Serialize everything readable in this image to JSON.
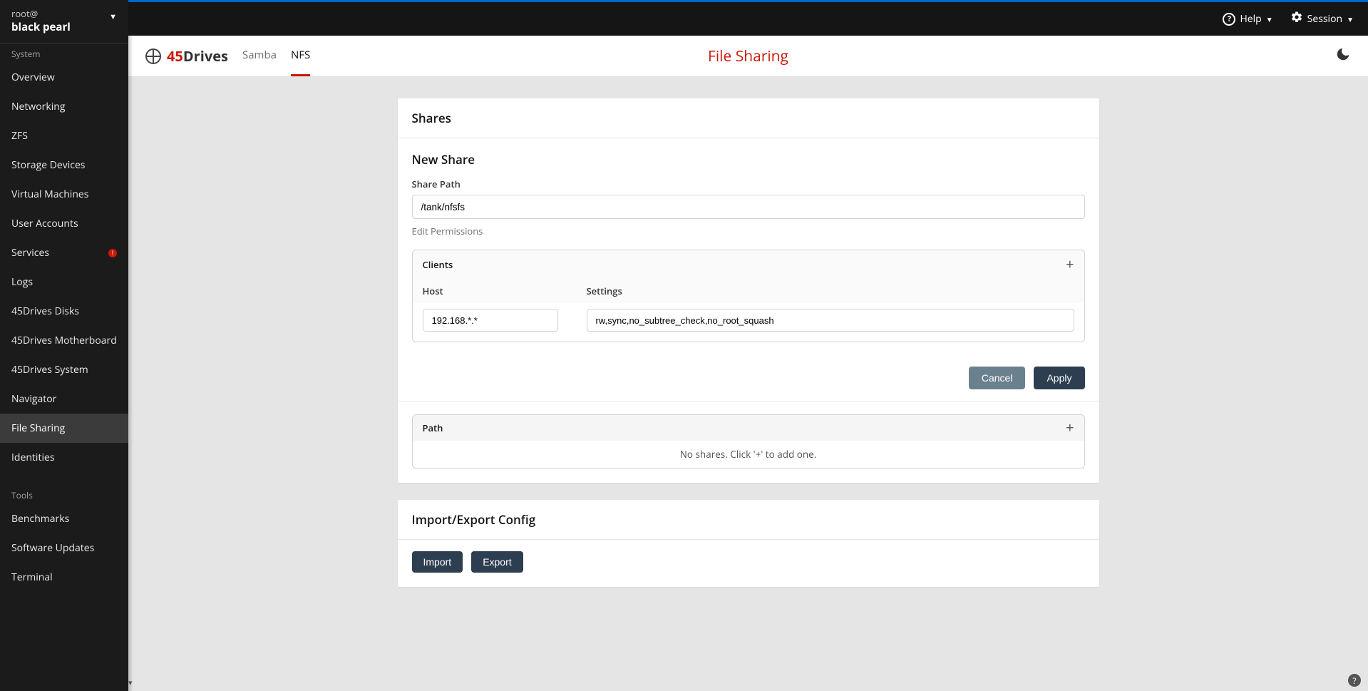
{
  "host": {
    "user": "root@",
    "name": "black pearl"
  },
  "sidebar": {
    "section1_label": "System",
    "items1": [
      {
        "label": "Overview"
      },
      {
        "label": "Networking"
      },
      {
        "label": "ZFS"
      },
      {
        "label": "Storage Devices"
      },
      {
        "label": "Virtual Machines"
      },
      {
        "label": "User Accounts"
      },
      {
        "label": "Services",
        "alert": true
      },
      {
        "label": "Logs"
      },
      {
        "label": "45Drives Disks"
      },
      {
        "label": "45Drives Motherboard"
      },
      {
        "label": "45Drives System"
      },
      {
        "label": "Navigator"
      },
      {
        "label": "File Sharing",
        "active": true
      },
      {
        "label": "Identities"
      }
    ],
    "section2_label": "Tools",
    "items2": [
      {
        "label": "Benchmarks"
      },
      {
        "label": "Software Updates"
      },
      {
        "label": "Terminal"
      }
    ]
  },
  "topbar": {
    "help": "Help",
    "session": "Session"
  },
  "subheader": {
    "brand_red": "45",
    "brand_dark": "Drives",
    "tabs": [
      {
        "label": "Samba",
        "active": false
      },
      {
        "label": "NFS",
        "active": true
      }
    ],
    "title": "File Sharing"
  },
  "shares_card": {
    "title": "Shares",
    "new_share_title": "New Share",
    "share_path_label": "Share Path",
    "share_path_value": "/tank/nfsfs",
    "edit_permissions": "Edit Permissions",
    "clients_label": "Clients",
    "host_col": "Host",
    "settings_col": "Settings",
    "host_value": "192.168.*.*",
    "settings_value": "rw,sync,no_subtree_check,no_root_squash",
    "cancel": "Cancel",
    "apply": "Apply",
    "path_col": "Path",
    "empty_msg": "No shares. Click '+' to add one."
  },
  "import_card": {
    "title": "Import/Export Config",
    "import": "Import",
    "export": "Export"
  }
}
